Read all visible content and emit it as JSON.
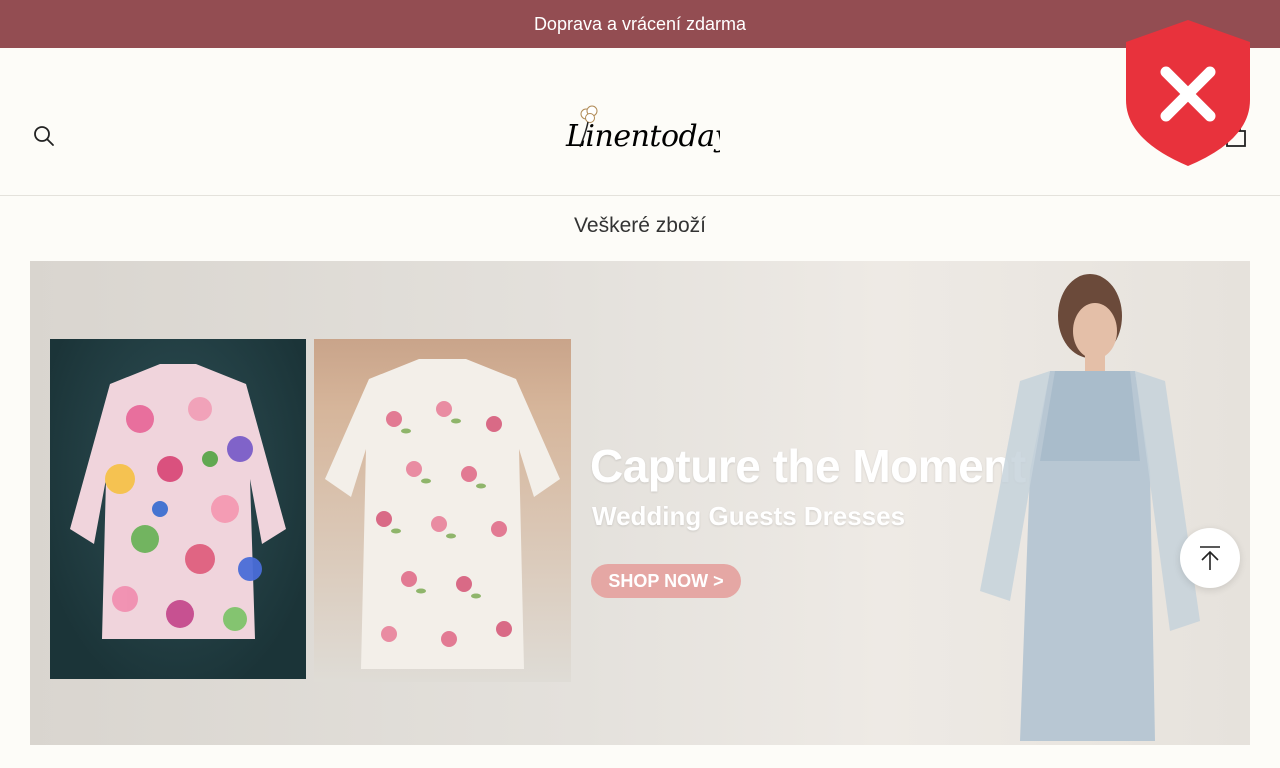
{
  "announcement": {
    "text": "Doprava a vrácení zdarma"
  },
  "header": {
    "logo_text": "Linentoday",
    "search_icon": "search-icon",
    "cart_icon": "cart-icon"
  },
  "collection": {
    "title": "Veškeré zboží"
  },
  "banner": {
    "headline": "Capture the Moment",
    "subheadline": "Wedding Guests Dresses",
    "cta_label": "SHOP NOW >"
  },
  "overlay": {
    "icon": "close-shield-icon"
  },
  "scroll_top": {
    "icon": "arrow-up-icon"
  },
  "colors": {
    "announcement_bg": "#934d52",
    "page_bg": "#fdfcf8",
    "cta_bg": "#e5a7a4",
    "shield_red": "#e8323c"
  }
}
